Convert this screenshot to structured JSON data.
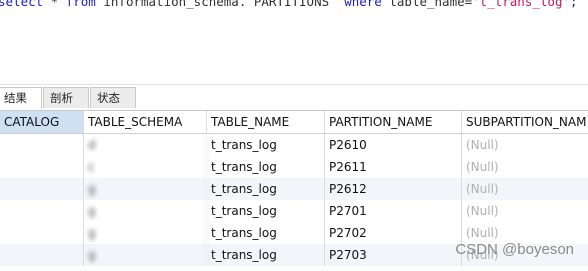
{
  "editor": {
    "sql_parts": {
      "k1": "select",
      "s1": " * ",
      "k2": "from",
      "s2": " information_schema.`PARTITIONS` ",
      "k3": "where",
      "s3": " table_name=",
      "str": "'t_trans_log'",
      "end": ";"
    }
  },
  "tabs": [
    {
      "label": "结果 1"
    },
    {
      "label": "剖析"
    },
    {
      "label": "状态"
    }
  ],
  "table": {
    "columns": [
      "CATALOG",
      "TABLE_SCHEMA",
      "TABLE_NAME",
      "PARTITION_NAME",
      "SUBPARTITION_NAM"
    ],
    "rows": [
      {
        "catalog": "",
        "schema": "d",
        "table_name": "t_trans_log",
        "partition": "P2610",
        "sub": "(Null)"
      },
      {
        "catalog": "",
        "schema": "c",
        "table_name": "t_trans_log",
        "partition": "P2611",
        "sub": "(Null)"
      },
      {
        "catalog": "",
        "schema": "g",
        "table_name": "t_trans_log",
        "partition": "P2612",
        "sub": "(Null)"
      },
      {
        "catalog": "",
        "schema": "g",
        "table_name": "t_trans_log",
        "partition": "P2701",
        "sub": "(Null)"
      },
      {
        "catalog": "",
        "schema": "g",
        "table_name": "t_trans_log",
        "partition": "P2702",
        "sub": "(Null)"
      },
      {
        "catalog": "",
        "schema": "g",
        "table_name": "t_trans_log",
        "partition": "P2703",
        "sub": "(Null)"
      }
    ]
  },
  "watermark": "CSDN @boyeson",
  "colors": {
    "keyword": "#1a1ad0",
    "string": "#c2185b",
    "selected_header": "#cfe0f4"
  }
}
